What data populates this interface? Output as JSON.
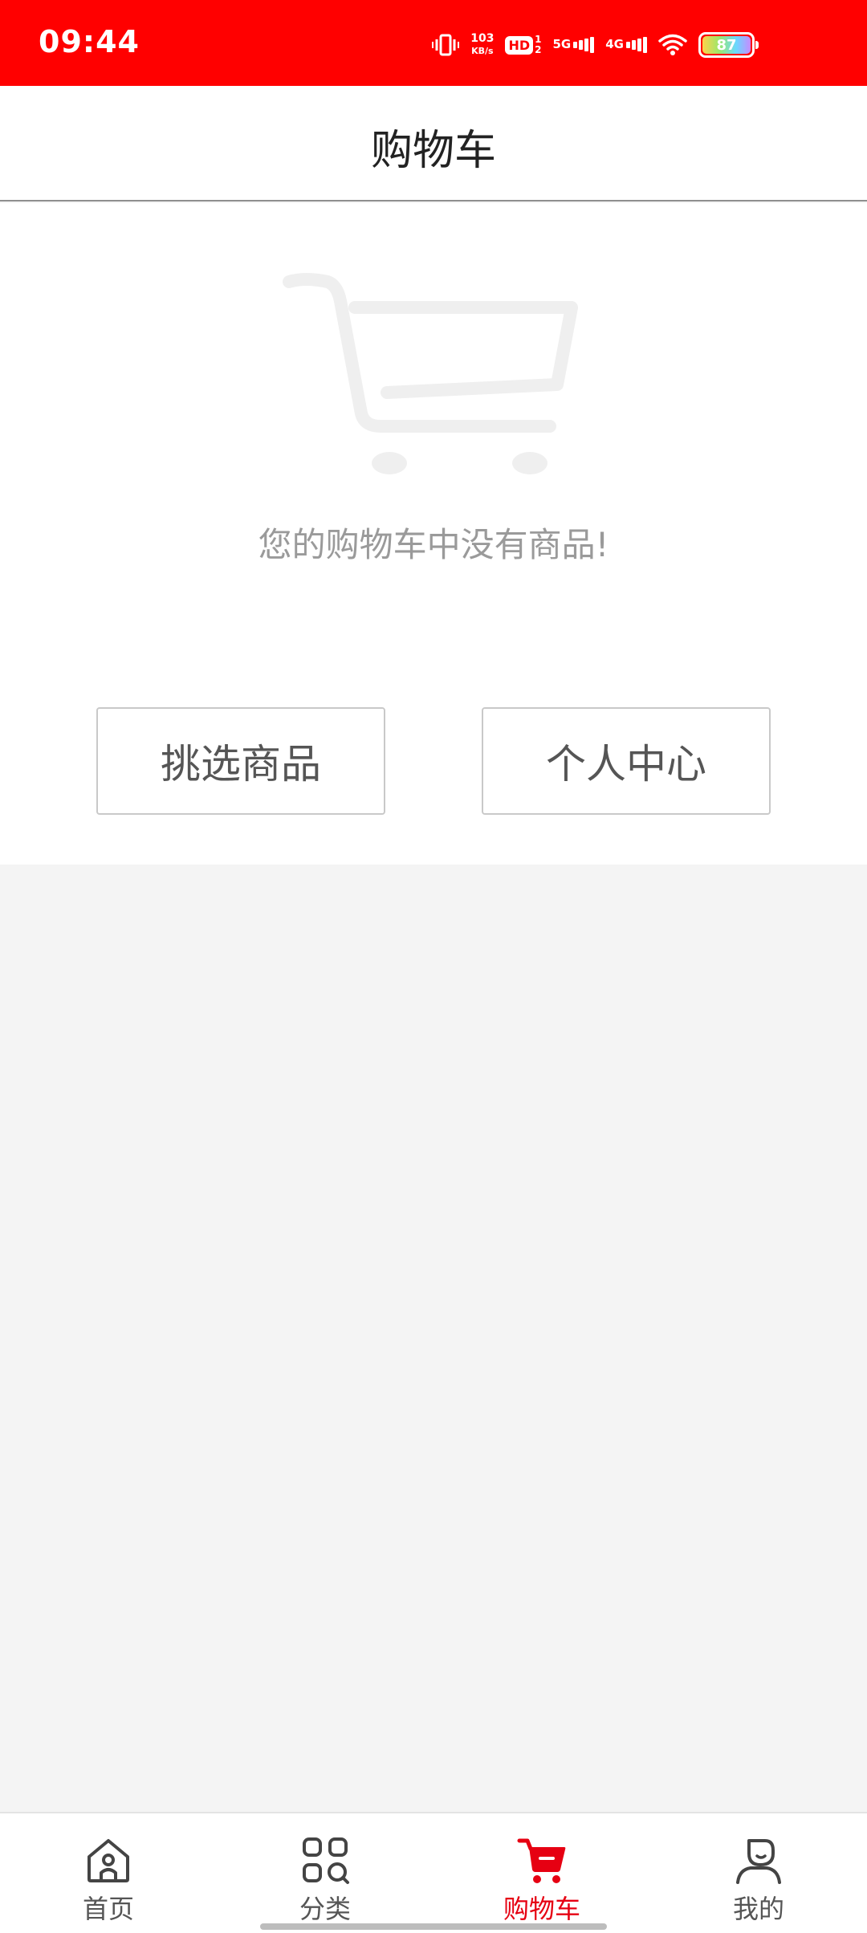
{
  "status_bar": {
    "time": "09:44",
    "net_speed_value": "103",
    "net_speed_unit": "KB/s",
    "hd_label": "HD",
    "hd_sub_top": "1",
    "hd_sub_bottom": "2",
    "sig1_label": "5G",
    "sig2_label": "4G",
    "battery_level": "87",
    "icons": [
      "vibrate-icon",
      "hd-icon",
      "signal-5g-icon",
      "signal-4g-icon",
      "wifi-icon",
      "battery-icon"
    ]
  },
  "header": {
    "title": "购物车"
  },
  "empty_state": {
    "message": "您的购物车中没有商品!",
    "illustration": "empty-cart-illustration",
    "browse_button": "挑选商品",
    "profile_button": "个人中心"
  },
  "bottom_nav": {
    "items": [
      {
        "label": "首页",
        "icon": "home-icon",
        "active": false
      },
      {
        "label": "分类",
        "icon": "category-icon",
        "active": false
      },
      {
        "label": "购物车",
        "icon": "cart-icon",
        "active": true
      },
      {
        "label": "我的",
        "icon": "user-icon",
        "active": false
      }
    ]
  },
  "colors": {
    "status_bar": "#ff0000",
    "active_tab": "#e60012",
    "page_background": "#f4f4f4"
  }
}
